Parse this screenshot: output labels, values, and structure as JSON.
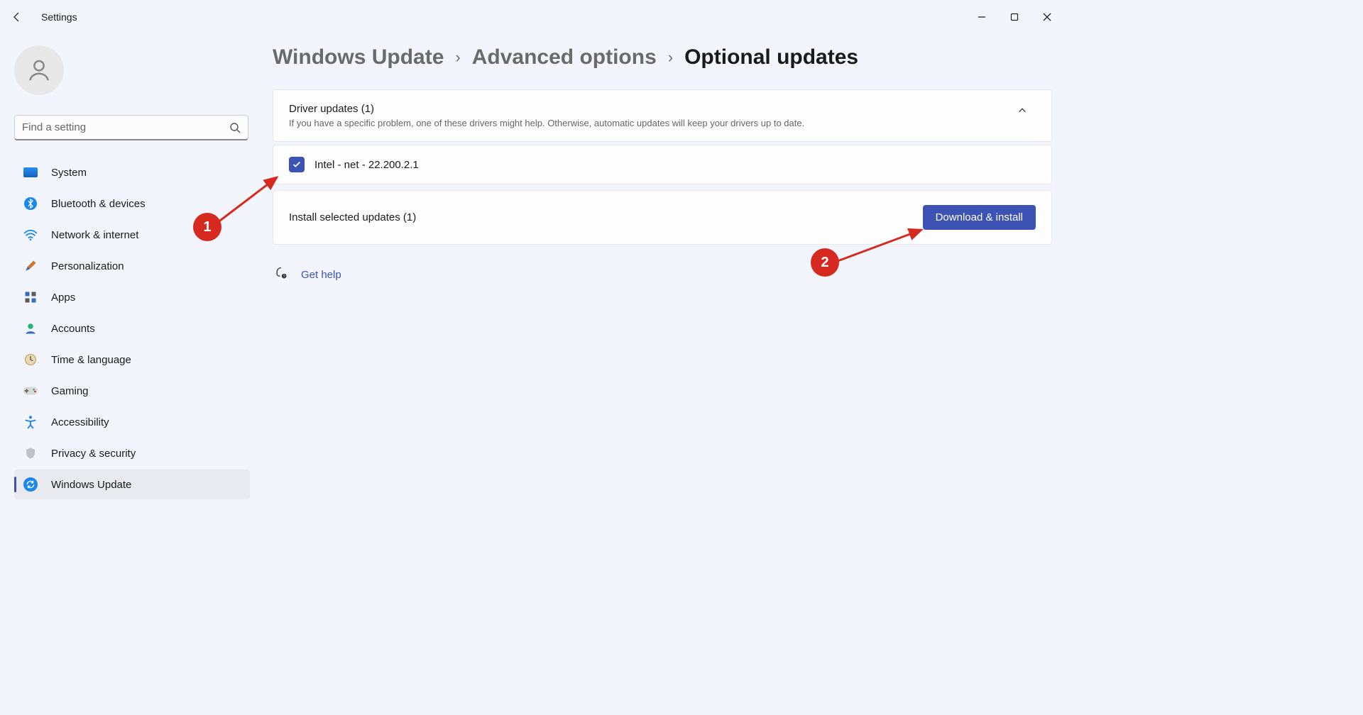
{
  "app": {
    "title": "Settings"
  },
  "search": {
    "placeholder": "Find a setting"
  },
  "sidebar": {
    "items": [
      {
        "label": "System"
      },
      {
        "label": "Bluetooth & devices"
      },
      {
        "label": "Network & internet"
      },
      {
        "label": "Personalization"
      },
      {
        "label": "Apps"
      },
      {
        "label": "Accounts"
      },
      {
        "label": "Time & language"
      },
      {
        "label": "Gaming"
      },
      {
        "label": "Accessibility"
      },
      {
        "label": "Privacy & security"
      },
      {
        "label": "Windows Update"
      }
    ]
  },
  "breadcrumb": {
    "a": "Windows Update",
    "b": "Advanced options",
    "c": "Optional updates"
  },
  "driver_section": {
    "title": "Driver updates (1)",
    "subtitle": "If you have a specific problem, one of these drivers might help. Otherwise, automatic updates will keep your drivers up to date.",
    "items": [
      {
        "name": "Intel - net - 22.200.2.1"
      }
    ]
  },
  "install": {
    "label": "Install selected updates (1)",
    "button": "Download & install"
  },
  "help": {
    "label": "Get help"
  },
  "annotations": {
    "m1": "1",
    "m2": "2"
  }
}
